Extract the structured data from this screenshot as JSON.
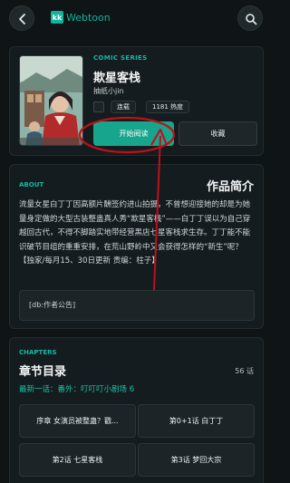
{
  "app": {
    "logo_mark": "kk",
    "logo_text": "Webtoon"
  },
  "comic": {
    "series_label": "COMIC SERIES",
    "title": "欺星客栈",
    "author": "抽纸小jin",
    "status": "连载",
    "popularity": "1181 热度",
    "read_button": "开始阅读",
    "favorite_button": "收藏"
  },
  "about": {
    "label": "ABOUT",
    "heading": "作品简介",
    "description": "流量女星白丁丁因高额片酬签约进山拍摄，不曾想迎接她的却是为她量身定做的大型古装整蛊真人秀“欺星客栈”——白丁丁误以为自己穿越回古代，不得不脚踏实地带经营黑店七星客栈求生存。丁丁能不能识破节目组的重重安排，在荒山野岭中又会获得怎样的“新生”呢？【独家/每月15、30日更新 责编：柱子】",
    "notice": "[db:作者公告]"
  },
  "chapters": {
    "label": "CHAPTERS",
    "heading": "章节目录",
    "count": "56 话",
    "latest": "最新一话：番外：叮叮叮小剧场 6",
    "items": [
      {
        "label": "序章 女演员被整蛊？戳..."
      },
      {
        "label": "第0+1话 白丁丁"
      },
      {
        "label": "第2话 七星客栈"
      },
      {
        "label": "第3话 梦回大宗"
      }
    ]
  },
  "colors": {
    "accent": "#17a58d",
    "background": "#0f1416",
    "card": "#151c1f",
    "annotation": "#c0101a"
  }
}
